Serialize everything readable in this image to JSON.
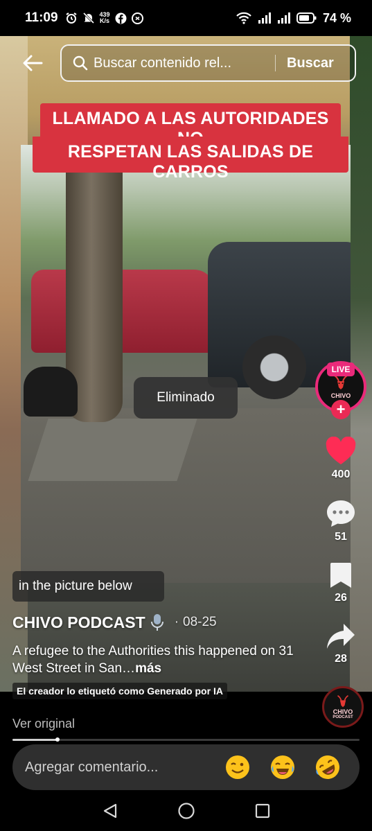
{
  "status_bar": {
    "time": "11:09",
    "net_speed_value": "439",
    "net_speed_unit": "K/s",
    "battery_percent": "74 %",
    "icons": [
      "alarm-icon",
      "mute-icon",
      "facebook-icon",
      "shazam-icon",
      "wifi-icon",
      "signal-icon",
      "signal-icon",
      "battery-icon"
    ]
  },
  "search": {
    "placeholder": "Buscar contenido rel...",
    "button_label": "Buscar"
  },
  "video": {
    "headline_line1": "LLAMADO A LAS AUTORIDADES NO",
    "headline_line2": "RESPETAN LAS SALIDAS DE CARROS",
    "toast": "Eliminado",
    "overlay_caption": "in the picture below"
  },
  "rail": {
    "live_badge": "LIVE",
    "avatar_name": "CHIVO",
    "likes": "400",
    "comments": "51",
    "saves": "26",
    "shares": "28"
  },
  "post": {
    "author": "CHIVO PODCAST",
    "date": "08-25",
    "description": "A refugee to the Authorities this happened on 31 West Street in San…",
    "more_label": "más",
    "ai_label": "El creador lo etiquetó como Generado por IA",
    "disc_name": "CHIVO",
    "disc_sub": "PODCAST"
  },
  "footer": {
    "ver_original": "Ver original",
    "progress": 0.13,
    "comment_placeholder": "Agregar comentario...",
    "emojis": [
      "wink-emoji",
      "tears-of-joy-emoji",
      "rolling-laughing-emoji"
    ]
  },
  "colors": {
    "accent_pink": "#ea2a7a",
    "headline_red": "#d8333f",
    "like_red": "#fe2c55"
  }
}
